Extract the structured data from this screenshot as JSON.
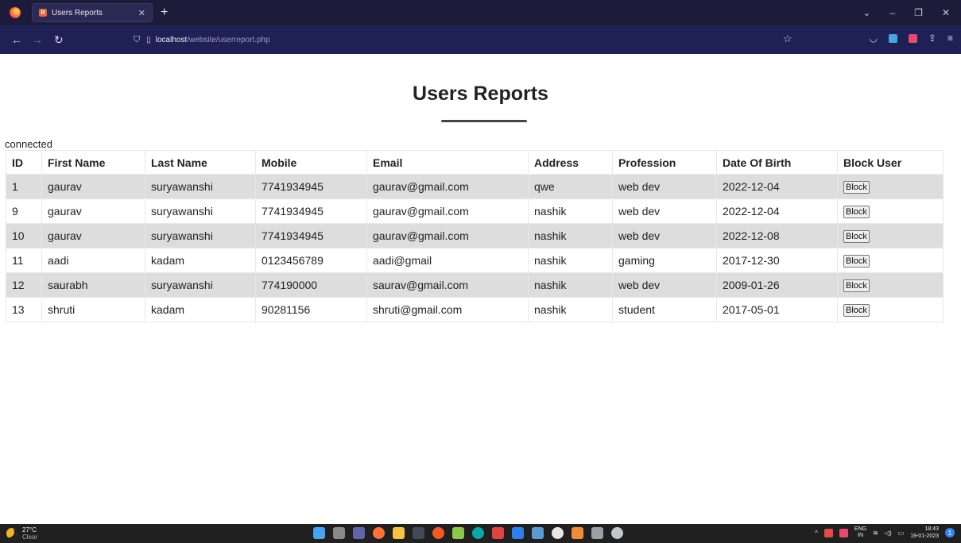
{
  "browser": {
    "tab_title": "Users Reports",
    "tab_favicon_text": "R",
    "url_host": "localhost",
    "url_path": "/website/userreport.php"
  },
  "page": {
    "title": "Users Reports",
    "status_text": "connected"
  },
  "table": {
    "headers": [
      "ID",
      "First Name",
      "Last Name",
      "Mobile",
      "Email",
      "Address",
      "Profession",
      "Date Of Birth",
      "Block User"
    ],
    "button_label": "Block",
    "rows": [
      [
        "1",
        "gaurav",
        "suryawanshi",
        "7741934945",
        "gaurav@gmail.com",
        "qwe",
        "web dev",
        "2022-12-04"
      ],
      [
        "9",
        "gaurav",
        "suryawanshi",
        "7741934945",
        "gaurav@gmail.com",
        "nashik",
        "web dev",
        "2022-12-04"
      ],
      [
        "10",
        "gaurav",
        "suryawanshi",
        "7741934945",
        "gaurav@gmail.com",
        "nashik",
        "web dev",
        "2022-12-08"
      ],
      [
        "11",
        "aadi",
        "kadam",
        "0123456789",
        "aadi@gmail",
        "nashik",
        "gaming",
        "2017-12-30"
      ],
      [
        "12",
        "saurabh",
        "suryawanshi",
        "774190000",
        "saurav@gmail.com",
        "nashik",
        "web dev",
        "2009-01-26"
      ],
      [
        "13",
        "shruti",
        "kadam",
        "90281156",
        "shruti@gmail.com",
        "nashik",
        "student",
        "2017-05-01"
      ]
    ]
  },
  "taskbar": {
    "weather_temp": "27°C",
    "weather_desc": "Clear",
    "lang": "ENG",
    "lang_region": "IN",
    "time": "18:43",
    "date": "19-01-2023"
  },
  "colors": {
    "tabbar_bg": "#1c1b3a",
    "navbar_bg": "#1e2056",
    "row_stripe": "#dddddd"
  }
}
